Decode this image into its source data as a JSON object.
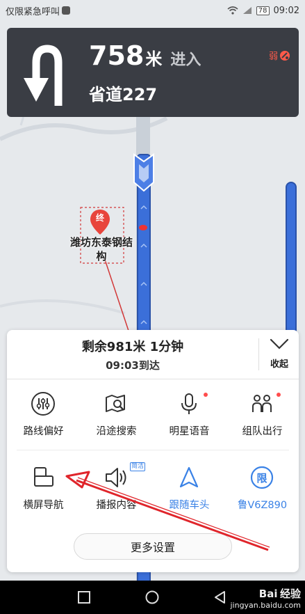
{
  "status_bar": {
    "emergency_text": "仅限紧急呼叫",
    "battery": "78",
    "time": "09:02"
  },
  "guidance": {
    "distance_value": "758",
    "distance_unit": "米",
    "action": "进入",
    "road_name": "省道227",
    "signal_label": "弱",
    "turn_icon": "u-turn-arrow-icon"
  },
  "map": {
    "destination_pin_label": "终",
    "destination_name": "潍坊东泰钢结构",
    "road_colors": {
      "route": "#3b6fd9",
      "route_outline": "#2a52a8",
      "road": "#c8d0da"
    }
  },
  "panel": {
    "remaining": "剩余981米 1分钟",
    "eta": "09:03到达",
    "collapse_label": "收起",
    "row1": [
      {
        "label": "路线偏好",
        "icon": "sliders-icon",
        "dot": false
      },
      {
        "label": "沿途搜索",
        "icon": "map-search-icon",
        "dot": false
      },
      {
        "label": "明星语音",
        "icon": "microphone-icon",
        "dot": true
      },
      {
        "label": "组队出行",
        "icon": "team-icon",
        "dot": true
      }
    ],
    "row2": [
      {
        "label": "横屏导航",
        "icon": "landscape-icon"
      },
      {
        "label": "播报内容",
        "icon": "speaker-icon",
        "tag": "简洁"
      },
      {
        "label": "跟随车头",
        "icon": "navigation-arrow-icon"
      },
      {
        "label": "鲁V6Z890",
        "icon": "restriction-icon",
        "icon_text": "限"
      }
    ],
    "more_settings": "更多设置"
  },
  "watermark": {
    "line1": "Bai",
    "line2": "经验",
    "line3": "jingyan.baidu.com"
  },
  "colors": {
    "accent_blue": "#3a82e6",
    "guide_bg": "#3a3d44",
    "arrow_red": "#e0252b"
  }
}
